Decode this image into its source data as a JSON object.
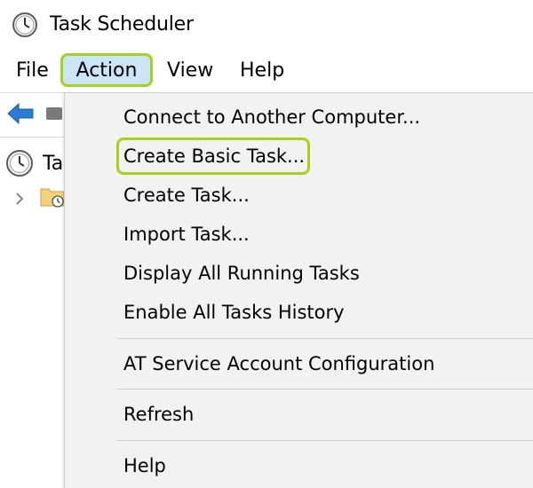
{
  "window": {
    "title": "Task Scheduler",
    "app_icon": "clock-icon"
  },
  "menubar": {
    "items": [
      {
        "label": "File"
      },
      {
        "label": "Action",
        "active": true
      },
      {
        "label": "View"
      },
      {
        "label": "Help"
      }
    ]
  },
  "toolbar": {
    "back_icon": "back-arrow-icon"
  },
  "tree": {
    "root_label": "Ta",
    "root_icon": "clock-icon",
    "child_icon": "folder-clock-icon",
    "expander_icon": "chevron-right-icon"
  },
  "action_menu": {
    "items": [
      {
        "label": "Connect to Another Computer..."
      },
      {
        "label": "Create Basic Task...",
        "highlighted": true
      },
      {
        "label": "Create Task..."
      },
      {
        "label": "Import Task..."
      },
      {
        "label": "Display All Running Tasks"
      },
      {
        "label": "Enable All Tasks History"
      },
      {
        "label": "AT Service Account Configuration"
      },
      {
        "label": "Refresh"
      },
      {
        "label": "Help"
      }
    ]
  },
  "colors": {
    "highlight_outline": "#a4d31a",
    "menu_active_bg": "#cce4f7",
    "dropdown_bg": "#f2f2f2",
    "back_arrow": "#2b7cd3"
  }
}
